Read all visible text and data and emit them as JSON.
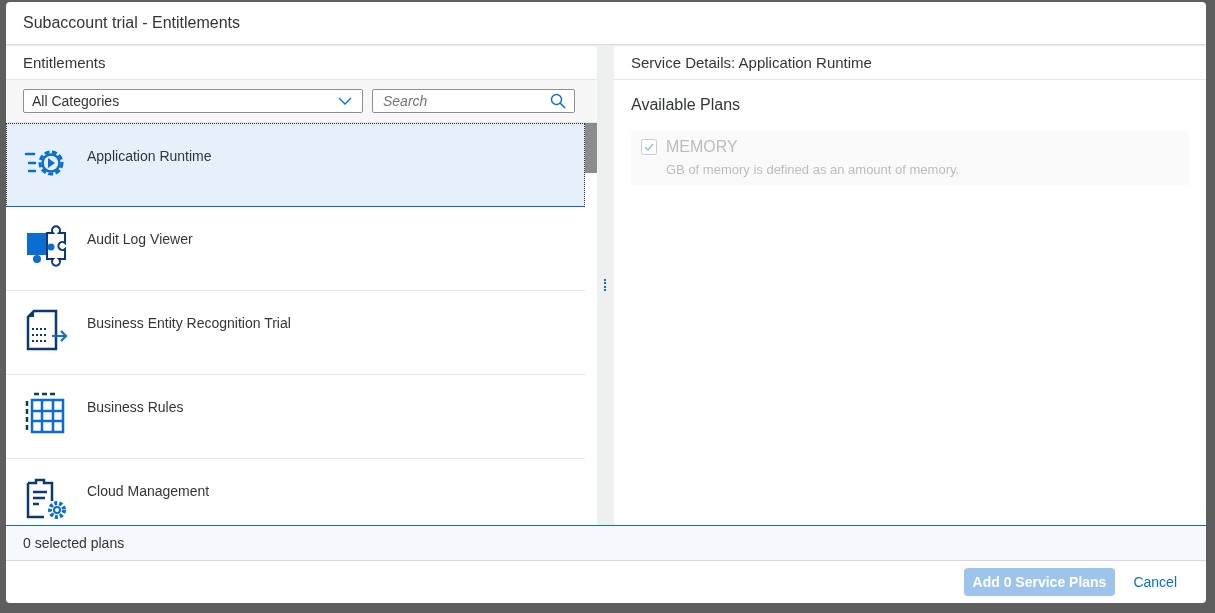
{
  "dialog": {
    "title": "Subaccount trial - Entitlements"
  },
  "entitlements": {
    "title": "Entitlements",
    "category_select": {
      "value": "All Categories"
    },
    "search": {
      "placeholder": "Search"
    },
    "services": [
      {
        "name": "Application Runtime",
        "selected": true
      },
      {
        "name": "Audit Log Viewer",
        "selected": false
      },
      {
        "name": "Business Entity Recognition Trial",
        "selected": false
      },
      {
        "name": "Business Rules",
        "selected": false
      },
      {
        "name": "Cloud Management",
        "selected": false
      }
    ]
  },
  "details": {
    "title": "Service Details: Application Runtime",
    "section": "Available Plans",
    "plans": [
      {
        "name": "MEMORY",
        "description": "GB of memory is defined as an amount of memory.",
        "checked": true,
        "disabled": true
      }
    ]
  },
  "status": "0 selected plans",
  "buttons": [
    {
      "label": "Add 0 Service Plans",
      "kind": "primary",
      "disabled": true
    },
    {
      "label": "Cancel",
      "kind": "link",
      "disabled": false
    }
  ]
}
